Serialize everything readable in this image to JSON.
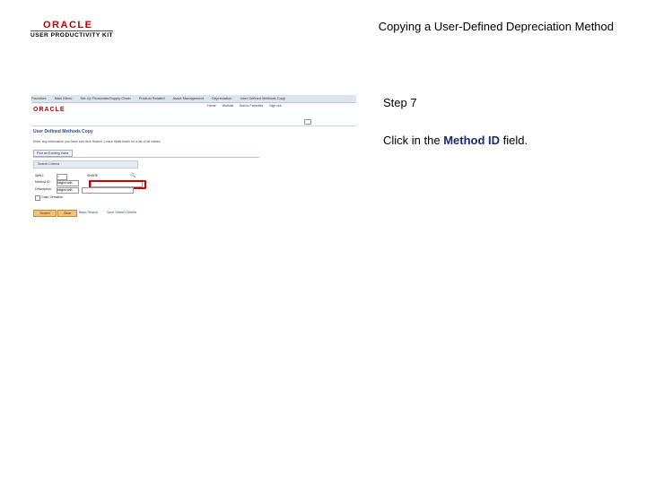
{
  "header": {
    "brand": "ORACLE",
    "brand_sub": "USER PRODUCTIVITY KIT",
    "doc_title": "Copying a User-Defined Depreciation Method"
  },
  "step": {
    "label": "Step 7",
    "instruction_pre": "Click in the ",
    "instruction_bold": "Method ID",
    "instruction_post": " field."
  },
  "screenshot": {
    "brand": "ORACLE",
    "topnav": [
      "Favorites",
      "Main Menu",
      "Set Up Financials/Supply Chain",
      "Product Related",
      "Asset Management",
      "Depreciation",
      "User Defined Methods Copy"
    ],
    "subnav": [
      "Home",
      "Worklist",
      "Add to Favorites",
      "Sign out"
    ],
    "page_title": "User Defined Methods Copy",
    "instructions": "Enter any information you have and click Search. Leave fields blank for a list of all values.",
    "find_tab": "Find an Existing Value",
    "criteria_label": "Search Criteria",
    "fields": [
      {
        "label": "SetID:",
        "op": "=",
        "value": "SHARE"
      },
      {
        "label": "Method ID:",
        "op": "begins with",
        "value": ""
      },
      {
        "label": "Description:",
        "op": "begins with",
        "value": ""
      }
    ],
    "case_sensitive": "Case Sensitive",
    "search_btn": "Search",
    "clear_btn": "Clear",
    "basic_link": "Basic Search",
    "save_link": "Save Search Criteria"
  }
}
